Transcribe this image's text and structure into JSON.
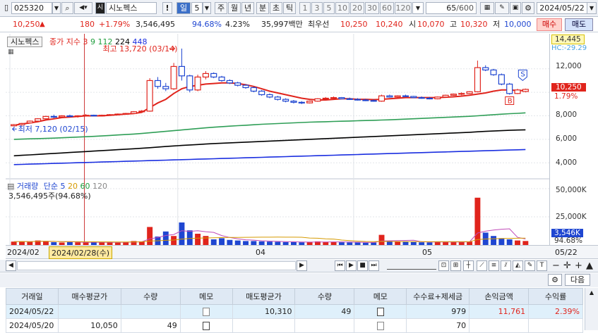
{
  "toolbar": {
    "code": "025320",
    "name_badge": "시",
    "name": "시노펙스",
    "excl": "!",
    "period_active": "일",
    "period_value": "5",
    "periods": [
      "주",
      "월",
      "년",
      "분",
      "초",
      "틱"
    ],
    "intervals": [
      "1",
      "3",
      "5",
      "10",
      "20",
      "30",
      "60",
      "120"
    ],
    "count": "65",
    "count_total": "/600",
    "date": "2024/05/22"
  },
  "info": {
    "price": "10,250",
    "change": "180",
    "change_pct": "+1.79%",
    "volume": "3,546,495",
    "vol_ratio": "94.68%",
    "turnover": "4.23%",
    "amount": "35,997백만",
    "priority_label": "최우선",
    "ask": "10,250",
    "bid": "10,240",
    "open_label": "시",
    "open": "10,070",
    "high_label": "고",
    "high": "10,320",
    "low_label": "저",
    "low": "10,000",
    "buy": "매수",
    "sell": "매도"
  },
  "chart": {
    "title": "시노펙스",
    "ma_title": "종가 지수 3",
    "ma_periods": [
      "9",
      "112",
      "224",
      "448"
    ],
    "high_label": "최고 13,720 (03/14)",
    "low_label": "최저 7,120 (02/15)",
    "price_tag": "10,250",
    "pct_tag": "1.79%",
    "top_tag": "14,445",
    "hc_tag": "HC:-29.29",
    "y_ticks": [
      "12,000",
      "10,000",
      "8,000",
      "6,000",
      "4,000"
    ],
    "vol_title": "거래량",
    "vol_ma_title": "단순 5",
    "vol_ma_periods": [
      "20",
      "60",
      "120"
    ],
    "vol_label": "3,546,495주(94.68%)",
    "vol_ticks": [
      "50,000K",
      "25,000K"
    ],
    "vol_tag": "3,546K",
    "vol_pct_tag": "94.68%",
    "marker_s": "S",
    "marker_b": "B"
  },
  "xaxis": {
    "start": "2024/02",
    "cursor": "2024/02/28(수)",
    "m4": "04",
    "m5": "05",
    "end": "05/22"
  },
  "table": {
    "next_button": "다음",
    "headers": [
      "거래일",
      "매수평균가",
      "수량",
      "메모",
      "매도평균가",
      "수량",
      "메모",
      "수수료+제세금",
      "손익금액",
      "수익률"
    ],
    "rows": [
      {
        "date": "2024/05/22",
        "buy_avg": "",
        "buy_qty": "",
        "sell_avg": "10,310",
        "sell_qty": "49",
        "fee": "979",
        "pnl": "11,761",
        "rate": "2.39%"
      },
      {
        "date": "2024/05/20",
        "buy_avg": "10,050",
        "buy_qty": "49",
        "sell_avg": "",
        "sell_qty": "",
        "fee": "70",
        "pnl": "",
        "rate": ""
      }
    ]
  },
  "chart_data": {
    "type": "candlestick",
    "ylim": [
      3000,
      14500
    ],
    "candles": [
      [
        7150,
        7300,
        7100,
        7250
      ],
      [
        7250,
        7400,
        7150,
        7350
      ],
      [
        7400,
        7600,
        7350,
        7550
      ],
      [
        7550,
        7800,
        7500,
        7750
      ],
      [
        7750,
        8000,
        7700,
        7950
      ],
      [
        7950,
        8100,
        7800,
        7900
      ],
      [
        7900,
        8050,
        7850,
        8000
      ],
      [
        8000,
        8100,
        7900,
        7950
      ],
      [
        7950,
        8050,
        7850,
        8000
      ],
      [
        8000,
        8150,
        7950,
        8050
      ],
      [
        8050,
        8100,
        7950,
        8000
      ],
      [
        8000,
        8100,
        7950,
        8050
      ],
      [
        8050,
        8150,
        8000,
        8100
      ],
      [
        8100,
        8200,
        8050,
        8150
      ],
      [
        8150,
        8250,
        8100,
        8200
      ],
      [
        8200,
        8400,
        8150,
        8350
      ],
      [
        8350,
        8500,
        8250,
        8400
      ],
      [
        8400,
        11200,
        8350,
        11000
      ],
      [
        11000,
        11300,
        10300,
        10500
      ],
      [
        10500,
        10800,
        10100,
        10300
      ],
      [
        10300,
        12500,
        10200,
        12200
      ],
      [
        12200,
        13720,
        11000,
        11400
      ],
      [
        11400,
        11500,
        10000,
        10200
      ],
      [
        10200,
        11500,
        10100,
        11300
      ],
      [
        11300,
        11800,
        11100,
        11600
      ],
      [
        11600,
        11700,
        11200,
        11300
      ],
      [
        11300,
        11400,
        10900,
        11000
      ],
      [
        11000,
        11100,
        10700,
        10800
      ],
      [
        10800,
        10900,
        10500,
        10600
      ],
      [
        10600,
        10700,
        10300,
        10400
      ],
      [
        10400,
        10500,
        10000,
        10100
      ],
      [
        10100,
        10200,
        9700,
        9800
      ],
      [
        9800,
        9900,
        9500,
        9600
      ],
      [
        9600,
        9700,
        9300,
        9400
      ],
      [
        9400,
        9500,
        9150,
        9250
      ],
      [
        9250,
        9350,
        9050,
        9150
      ],
      [
        9150,
        9250,
        9000,
        9100
      ],
      [
        9100,
        9300,
        9050,
        9250
      ],
      [
        9250,
        9500,
        9200,
        9450
      ],
      [
        9450,
        9600,
        9350,
        9500
      ],
      [
        9500,
        9650,
        9400,
        9550
      ],
      [
        9550,
        9600,
        9400,
        9450
      ],
      [
        9450,
        9550,
        9350,
        9400
      ],
      [
        9400,
        9500,
        9300,
        9350
      ],
      [
        9350,
        9450,
        9250,
        9300
      ],
      [
        9300,
        9400,
        9200,
        9250
      ],
      [
        9250,
        9800,
        9200,
        9700
      ],
      [
        9700,
        9800,
        9550,
        9600
      ],
      [
        9600,
        9750,
        9550,
        9700
      ],
      [
        9700,
        9800,
        9600,
        9650
      ],
      [
        9650,
        9700,
        9500,
        9550
      ],
      [
        9550,
        9650,
        9450,
        9500
      ],
      [
        9500,
        9600,
        9400,
        9450
      ],
      [
        9450,
        9650,
        9400,
        9600
      ],
      [
        9600,
        9800,
        9550,
        9750
      ],
      [
        9750,
        9900,
        9700,
        9850
      ],
      [
        9850,
        10000,
        9750,
        9900
      ],
      [
        9900,
        10100,
        9850,
        10050
      ],
      [
        10050,
        12700,
        10000,
        12100
      ],
      [
        12100,
        12300,
        11800,
        11900
      ],
      [
        11900,
        12000,
        11400,
        11500
      ],
      [
        11500,
        11600,
        10600,
        10700
      ],
      [
        10700,
        10800,
        9800,
        9900
      ],
      [
        9900,
        10300,
        9850,
        10200
      ],
      [
        10070,
        10320,
        10000,
        10250
      ]
    ],
    "ma_lines": {
      "9": [
        7200,
        7300,
        7400,
        7500,
        7650,
        7750,
        7850,
        7900,
        7950,
        8000,
        8000,
        8000,
        8050,
        8100,
        8150,
        8200,
        8300,
        8700,
        9100,
        9400,
        9900,
        10300,
        10500,
        10600,
        10700,
        10750,
        10800,
        10800,
        10750,
        10650,
        10500,
        10300,
        10100,
        9950,
        9800,
        9650,
        9500,
        9400,
        9350,
        9350,
        9400,
        9450,
        9450,
        9400,
        9400,
        9380,
        9400,
        9450,
        9500,
        9550,
        9550,
        9550,
        9550,
        9550,
        9580,
        9620,
        9680,
        9750,
        9850,
        9950,
        10100,
        10200,
        10200,
        10150,
        10150
      ],
      "112": [
        6000,
        6020,
        6040,
        6060,
        6080,
        6100,
        6130,
        6160,
        6190,
        6220,
        6250,
        6290,
        6330,
        6370,
        6410,
        6450,
        6500,
        6560,
        6620,
        6680,
        6740,
        6800,
        6860,
        6920,
        6980,
        7030,
        7080,
        7120,
        7160,
        7200,
        7240,
        7280,
        7310,
        7340,
        7370,
        7400,
        7430,
        7460,
        7480,
        7500,
        7520,
        7540,
        7560,
        7580,
        7600,
        7620,
        7640,
        7660,
        7690,
        7720,
        7750,
        7780,
        7810,
        7840,
        7870,
        7900,
        7930,
        7960,
        8000,
        8050,
        8100,
        8140,
        8180,
        8210,
        8250
      ],
      "224": [
        4600,
        4640,
        4680,
        4720,
        4760,
        4800,
        4840,
        4880,
        4920,
        4960,
        5000,
        5040,
        5080,
        5120,
        5160,
        5200,
        5240,
        5290,
        5340,
        5390,
        5440,
        5480,
        5520,
        5560,
        5600,
        5640,
        5670,
        5700,
        5730,
        5760,
        5790,
        5820,
        5850,
        5880,
        5910,
        5940,
        5970,
        6000,
        6030,
        6060,
        6090,
        6120,
        6150,
        6180,
        6210,
        6240,
        6270,
        6300,
        6330,
        6360,
        6390,
        6420,
        6450,
        6480,
        6510,
        6540,
        6570,
        6600,
        6640,
        6680,
        6710,
        6740,
        6770,
        6790,
        6810
      ],
      "448": [
        3850,
        3870,
        3890,
        3910,
        3930,
        3950,
        3970,
        3990,
        4010,
        4030,
        4050,
        4070,
        4090,
        4110,
        4130,
        4150,
        4170,
        4190,
        4210,
        4230,
        4250,
        4270,
        4290,
        4310,
        4330,
        4350,
        4370,
        4390,
        4410,
        4430,
        4450,
        4470,
        4490,
        4510,
        4530,
        4550,
        4570,
        4590,
        4610,
        4630,
        4650,
        4670,
        4690,
        4710,
        4730,
        4750,
        4770,
        4790,
        4810,
        4830,
        4850,
        4870,
        4890,
        4910,
        4930,
        4950,
        4970,
        4990,
        5010,
        5030,
        5050,
        5070,
        5090,
        5110,
        5130
      ]
    },
    "volume_k": [
      3000,
      3200,
      2800,
      4000,
      3500,
      2500,
      2200,
      2600,
      2400,
      2300,
      2600,
      2200,
      2400,
      2100,
      2800,
      3500,
      3200,
      16000,
      7500,
      12000,
      8000,
      20000,
      13000,
      10000,
      8000,
      5000,
      6000,
      4500,
      4000,
      3500,
      3500,
      3200,
      3000,
      2800,
      2600,
      2500,
      2400,
      2600,
      3200,
      2800,
      2600,
      2400,
      2300,
      2200,
      2000,
      2100,
      9000,
      3500,
      3000,
      2800,
      2600,
      2400,
      2300,
      3000,
      2800,
      2600,
      2600,
      3000,
      42000,
      11000,
      8000,
      6000,
      5000,
      4000,
      3546
    ]
  }
}
